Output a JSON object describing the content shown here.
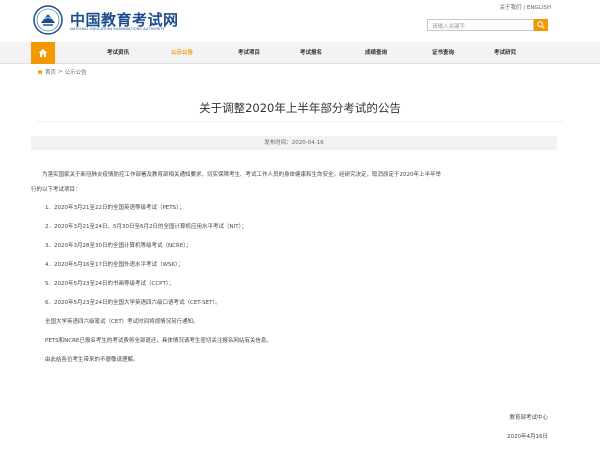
{
  "header": {
    "logo_cn": "中国教育考试网",
    "logo_en": "NATIONAL EDUCATION EXAMINATIONS AUTHORITY",
    "about": "关于我们",
    "sep": "|",
    "english": "ENGLISH",
    "search_placeholder": "请输入关键字"
  },
  "nav": {
    "items": [
      "考试资讯",
      "公示公告",
      "考试项目",
      "考试报名",
      "成绩查询",
      "证书查询",
      "考试研究"
    ],
    "active_index": 1
  },
  "breadcrumb": {
    "home": "首页",
    "sep": ">",
    "current": "公示公告"
  },
  "article": {
    "title": "关于调整2020年上半年部分考试的公告",
    "pub_time": "发布时间：2020-04-16",
    "intro_line1": "为落实国家关于新冠肺炎疫情防控工作部署及教育部相关通知要求，切实保障考生、考试工作人员的身体健康和生命安全，经研究决定，取消原定于2020年上半年举",
    "intro_line2": "行的以下考试项目：",
    "items": [
      "1．2020年3月21至22日的全国英语等级考试（PETS）；",
      "2．2020年3月21至24日，5月30日至6月2日的全国计算机应用水平考试（NIT）；",
      "3．2020年3月28至30日的全国计算机等级考试（NCRE）；",
      "4．2020年5月16至17日的全国外语水平考试（WSK）；",
      "5．2020年5月23至24日的书画等级考试（CCPT）；",
      "6．2020年5月23至24日的全国大学英语四六级口语考试（CET-SET）。"
    ],
    "note1": "全国大学英语四六级笔试（CET）考试时间将视情况另行通知。",
    "note2": "PETS和NCRE已报名考生的考试费将全部退还，具体情况请考生密切关注报名网站有关信息。",
    "note3": "由此给各位考生带来的不便敬请理解。",
    "sign_org": "教育部考试中心",
    "sign_date": "2020年4月16日"
  },
  "colors": {
    "brand_blue": "#1d4d8f",
    "accent_orange": "#f39800"
  }
}
